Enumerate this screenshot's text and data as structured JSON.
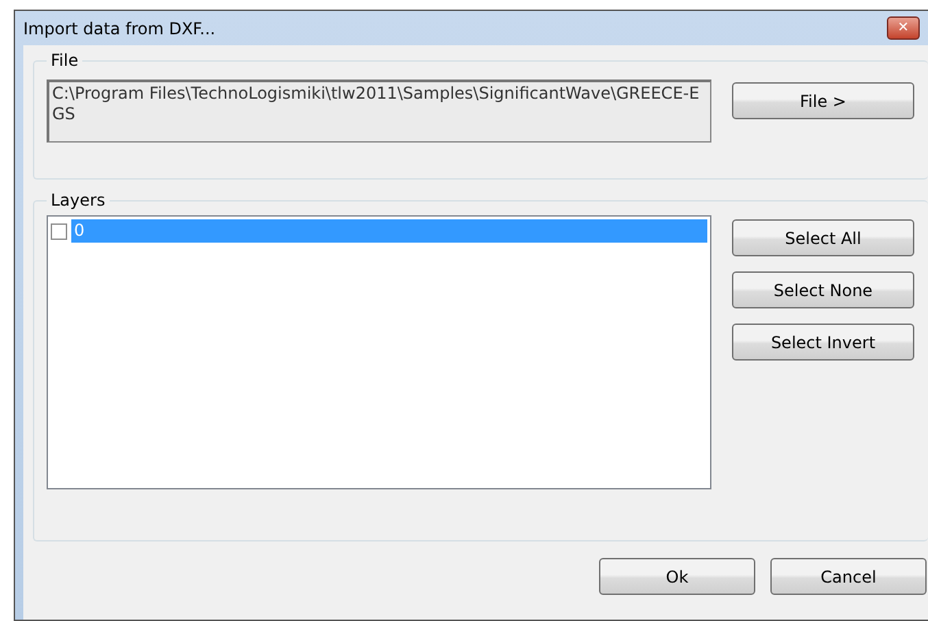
{
  "window": {
    "title": "Import data from DXF...",
    "close": "✕"
  },
  "file_group": {
    "label": "File",
    "path": "C:\\Program Files\\TechnoLogismiki\\tlw2011\\Samples\\SignificantWave\\GREECE-EGS",
    "button": "File >"
  },
  "layers_group": {
    "label": "Layers",
    "layers": [
      {
        "name": "0",
        "checked": false,
        "selected": true
      }
    ],
    "buttons": [
      "Select All",
      "Select None",
      "Select Invert"
    ]
  },
  "buttons": [
    "Ok",
    "Cancel"
  ]
}
